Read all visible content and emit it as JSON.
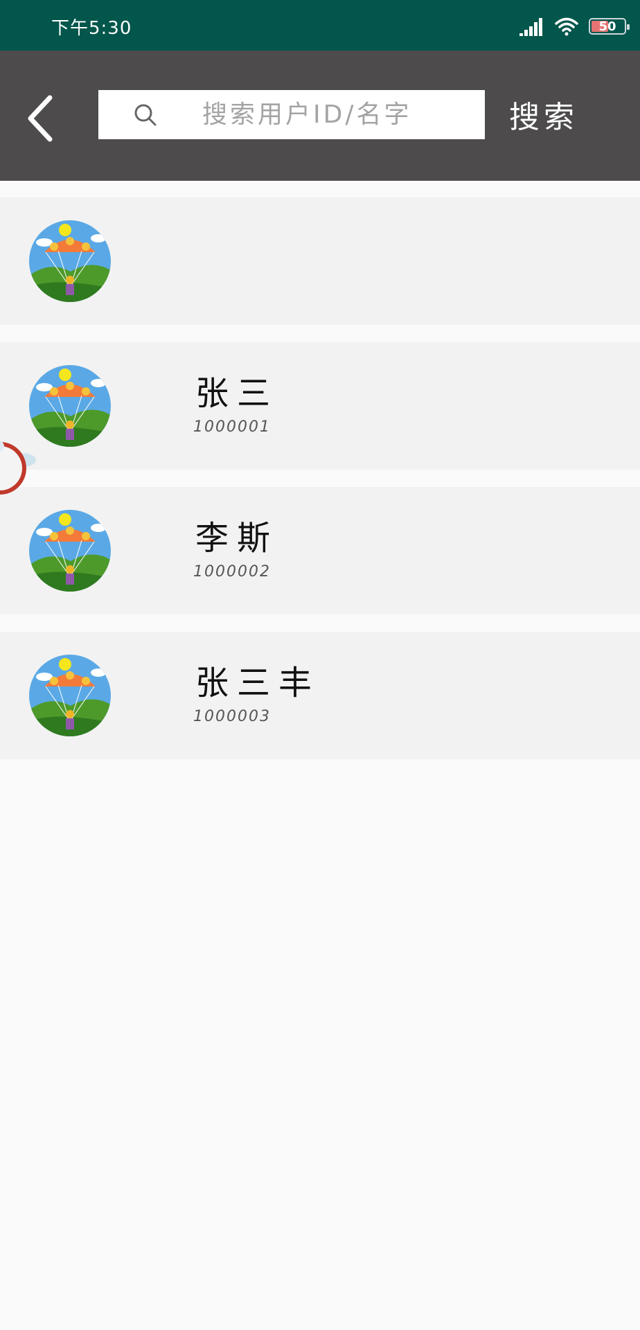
{
  "status_bar": {
    "time": "下午5:30",
    "battery_level": "50",
    "icons": [
      "signal-icon",
      "wifi-icon",
      "battery-charging-icon"
    ]
  },
  "header": {
    "back_icon": "chevron-left-icon",
    "search": {
      "placeholder": "搜索用户ID/名字",
      "value": "",
      "icon": "search-icon"
    },
    "search_button_label": "搜索"
  },
  "users": [
    {
      "name": "",
      "id": ""
    },
    {
      "name": "张三",
      "id": "1000001"
    },
    {
      "name": "李斯",
      "id": "1000002"
    },
    {
      "name": "张三丰",
      "id": "1000003"
    }
  ],
  "colors": {
    "status_bar": "#02564b",
    "header": "#4d4b4c",
    "row_background": "#f2f2f2",
    "page_background": "#fafafa"
  }
}
